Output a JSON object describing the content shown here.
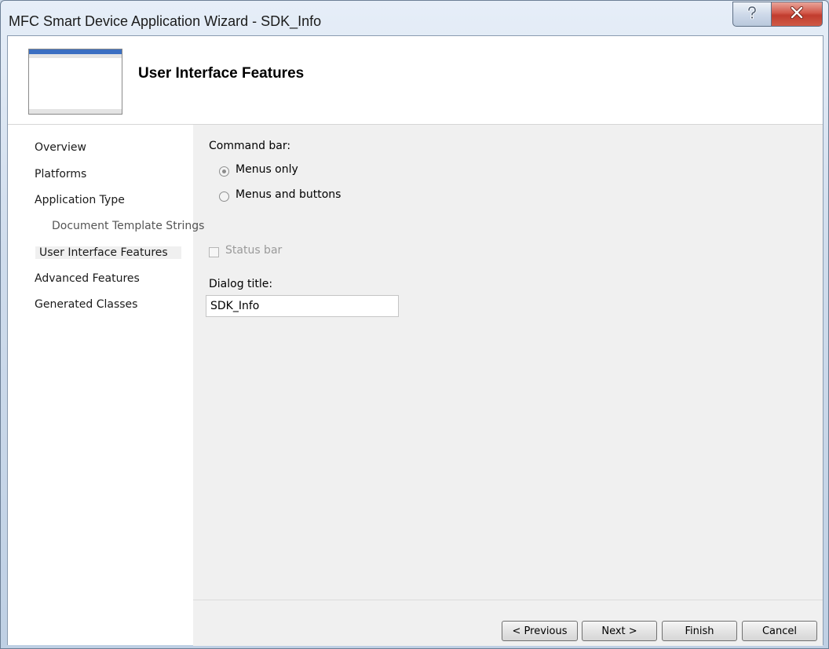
{
  "window": {
    "title": "MFC Smart Device Application Wizard - SDK_Info",
    "help_icon": "help-icon",
    "close_icon": "close-icon"
  },
  "header": {
    "title": "User Interface Features"
  },
  "nav": {
    "items": [
      {
        "label": "Overview"
      },
      {
        "label": "Platforms"
      },
      {
        "label": "Application Type"
      },
      {
        "label": "Document Template Strings"
      },
      {
        "label": "User Interface Features"
      },
      {
        "label": "Advanced Features"
      },
      {
        "label": "Generated Classes"
      }
    ],
    "selected": "User Interface Features"
  },
  "command_bar": {
    "label": "Command bar:",
    "options": [
      {
        "label": "Menus only",
        "checked": true
      },
      {
        "label": "Menus and buttons",
        "checked": false
      }
    ]
  },
  "status_bar": {
    "label": "Status bar",
    "checked": false,
    "enabled": false
  },
  "dialog_title": {
    "label": "Dialog title:",
    "value": "SDK_Info"
  },
  "buttons": {
    "previous": "< Previous",
    "next": "Next >",
    "finish": "Finish",
    "cancel": "Cancel"
  }
}
